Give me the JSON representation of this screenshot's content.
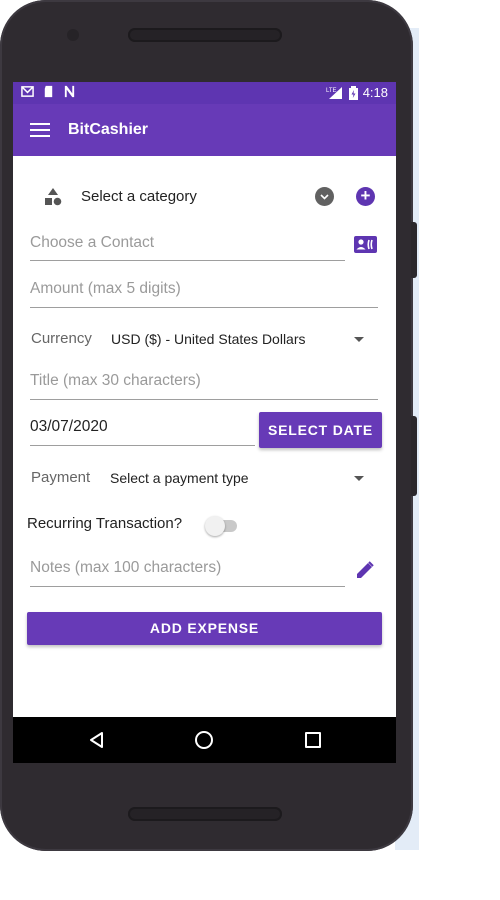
{
  "status_bar": {
    "time": "4:18",
    "network_label": "LTE",
    "left_icons": [
      "gmail-icon",
      "sd-card-icon",
      "n-notification-icon"
    ],
    "right_icons": [
      "signal-icon",
      "battery-icon"
    ]
  },
  "app_bar": {
    "title": "BitCashier",
    "menu_icon": "hamburger-menu-icon"
  },
  "category": {
    "label": "Select a category",
    "icon": "category-shapes-icon",
    "dropdown_icon": "dropdown-circle-icon",
    "add_icon": "add-circle-icon"
  },
  "contact": {
    "placeholder": "Choose a Contact",
    "icon": "contact-card-icon"
  },
  "amount": {
    "placeholder": "Amount (max 5 digits)"
  },
  "currency": {
    "label": "Currency",
    "selected": "USD ($) - United States Dollars"
  },
  "title_field": {
    "placeholder": "Title (max 30 characters)"
  },
  "date": {
    "value": "03/07/2020",
    "button_label": "SELECT DATE"
  },
  "payment": {
    "label": "Payment",
    "selected": "Select a payment type"
  },
  "recurring": {
    "label": "Recurring Transaction?",
    "checked": false
  },
  "notes": {
    "placeholder": "Notes (max 100 characters)",
    "icon": "edit-pencil-icon"
  },
  "submit": {
    "label": "ADD EXPENSE"
  },
  "nav": {
    "icons": [
      "back-icon",
      "home-icon",
      "recent-apps-icon"
    ]
  },
  "colors": {
    "primary": "#673ab7",
    "primary_dark": "#5e35b1",
    "accent": "#5e35b1"
  }
}
